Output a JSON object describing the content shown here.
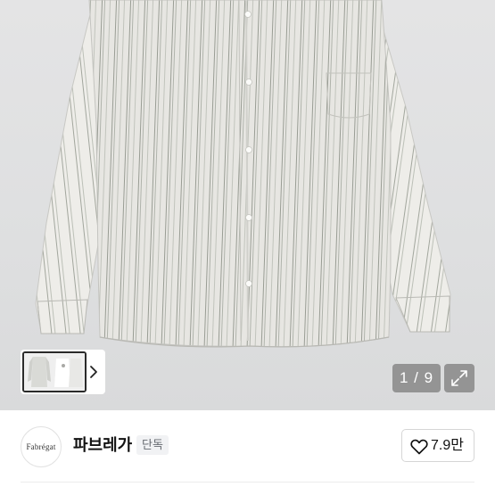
{
  "gallery": {
    "counter": "1 / 9",
    "thumb_alt": "product thumbnail"
  },
  "shop": {
    "logo_text": "Fabrégat",
    "name": "파브레가",
    "badge": "단독"
  },
  "like": {
    "count": "7.9만"
  },
  "icons": {
    "like": "heart-outline-icon",
    "expand": "expand-arrows-icon",
    "next": "chevron-right-icon"
  }
}
